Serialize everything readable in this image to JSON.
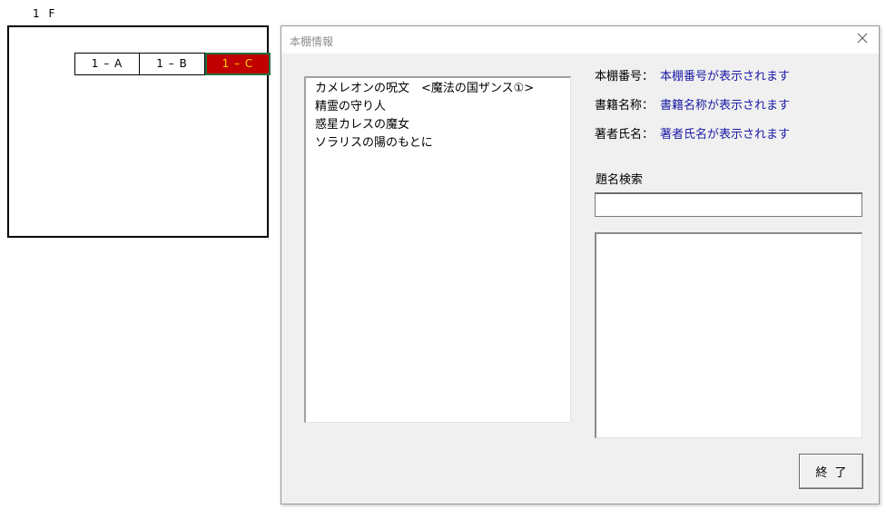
{
  "sheet": {
    "floor_label": "1 F",
    "shelves": [
      {
        "label": "1 – A"
      },
      {
        "label": "1 – B"
      },
      {
        "label": "1 – C"
      }
    ],
    "selected_color": "#c00000",
    "selected_text_color": "#ffd700"
  },
  "dialog": {
    "title": "本棚情報",
    "close_icon": "close-icon",
    "book_list": [
      "カメレオンの呪文　<魔法の国ザンス①>",
      "精霊の守り人",
      "惑星カレスの魔女",
      "ソラリスの陽のもとに"
    ],
    "info": {
      "shelf_number_label": "本棚番号：",
      "shelf_number_value": "本棚番号が表示されます",
      "book_title_label": "書籍名称：",
      "book_title_value": "書籍名称が表示されます",
      "author_label": "著者氏名：",
      "author_value": "著者氏名が表示されます"
    },
    "search": {
      "label": "題名検索",
      "value": ""
    },
    "end_button_label": "終了",
    "accent_value_color": "#1a1aa6"
  }
}
